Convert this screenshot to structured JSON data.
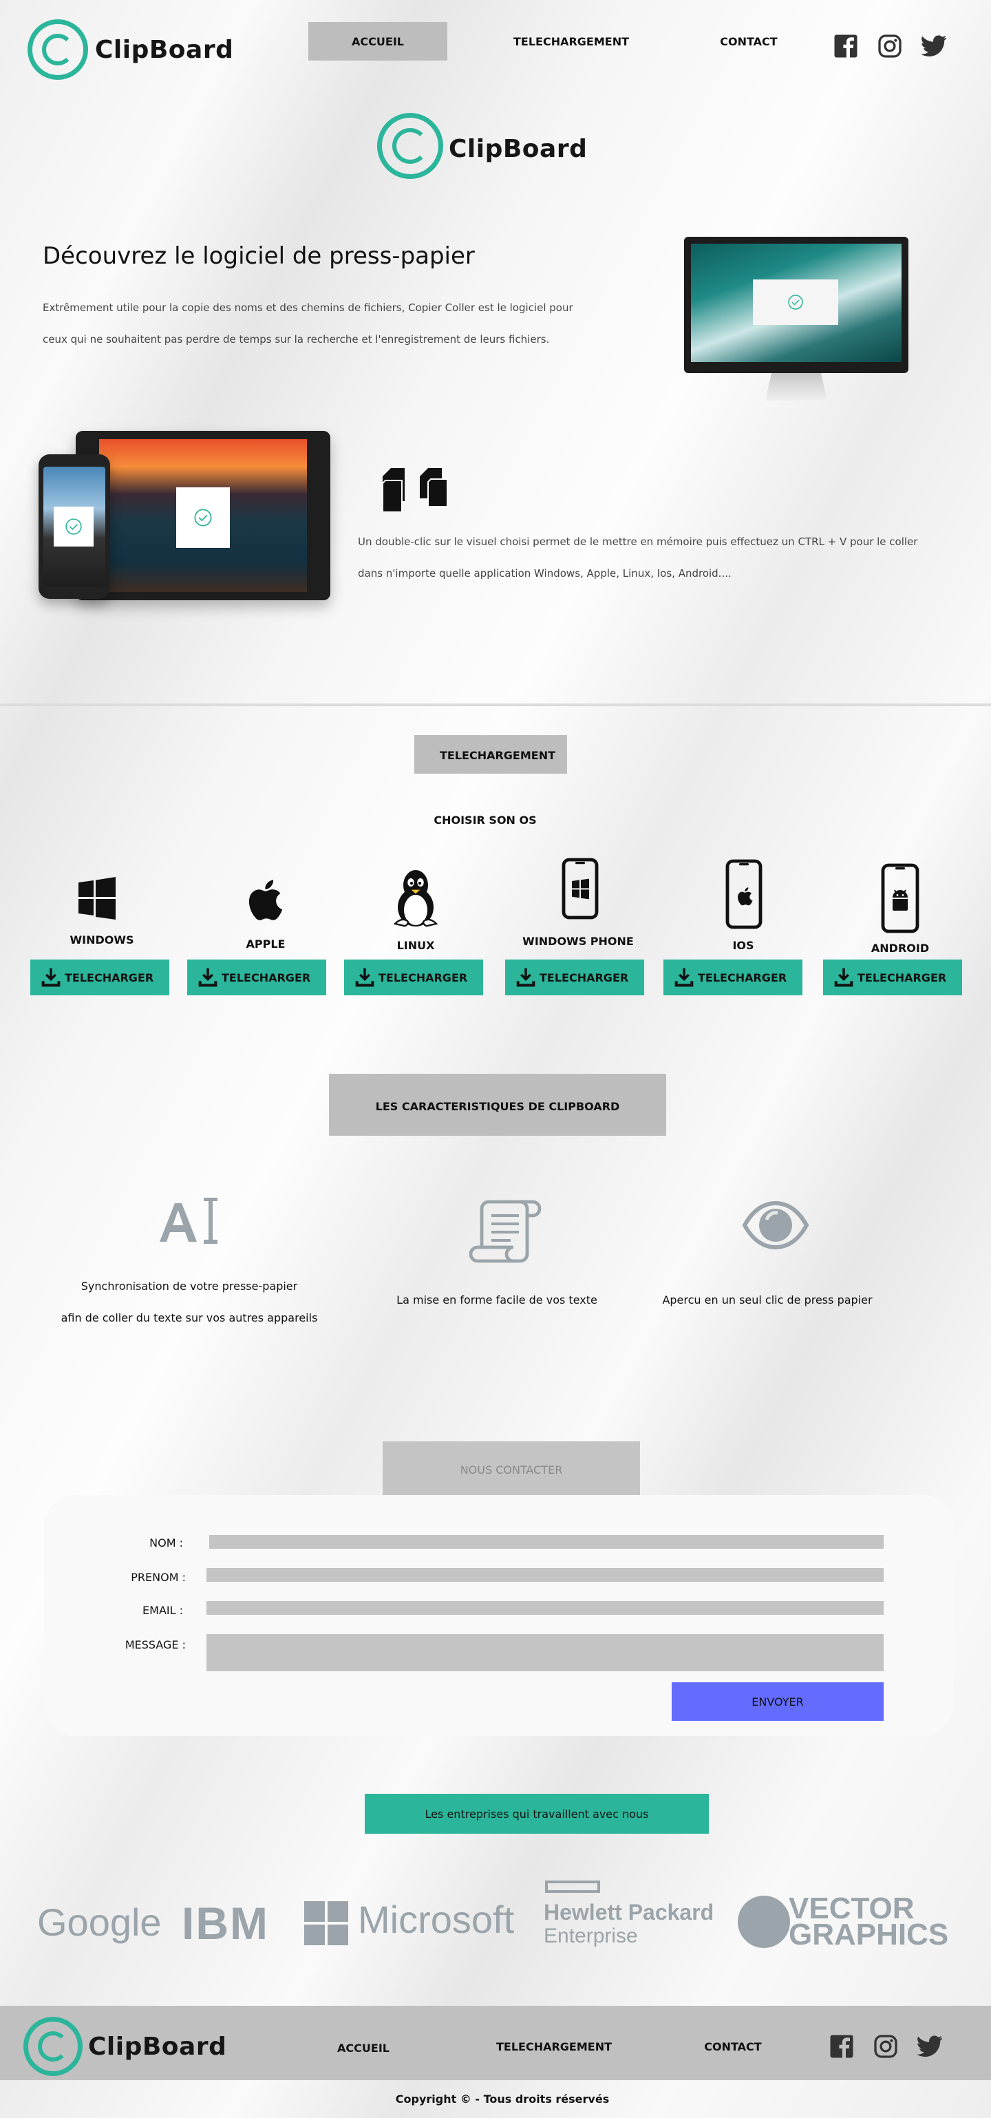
{
  "brand": {
    "name": "ClipBoard"
  },
  "nav": {
    "home": "ACCUEIL",
    "download": "TELECHARGEMENT",
    "contact": "CONTACT"
  },
  "hero": {
    "title": "Découvrez le logiciel de press-papier",
    "desc1": "Extrêmement utile pour la copie des noms et des chemins de fichiers, Copier Coller est le logiciel pour",
    "desc2": "ceux qui ne souhaitent pas perdre de temps sur la recherche et l'enregistrement de leurs fichiers.",
    "info1": "Un double-clic sur le visuel choisi permet de le mettre en mémoire puis effectuez un CTRL + V pour le coller",
    "info2": "dans n'importe quelle application Windows,  Apple, Linux, Ios, Android...."
  },
  "download": {
    "heading": "TELECHARGEMENT",
    "subheading": "CHOISIR SON OS",
    "button_label": "TELECHARGER",
    "os": [
      "WINDOWS",
      "APPLE",
      "LINUX",
      "WINDOWS PHONE",
      "IOS",
      "ANDROID"
    ]
  },
  "features": {
    "heading": "LES CARACTERISTIQUES DE CLIPBOARD",
    "items": [
      {
        "line1": "Synchronisation de votre presse-papier",
        "line2": "afin de coller du texte sur vos autres appareils",
        "icon": "text-ai-icon"
      },
      {
        "line1": "La mise en forme facile de vos texte",
        "line2": "",
        "icon": "scroll-document-icon"
      },
      {
        "line1": "Apercu en un seul clic de  press papier",
        "line2": "",
        "icon": "eye-icon"
      }
    ]
  },
  "contact": {
    "heading": "NOUS CONTACTER",
    "labels": {
      "nom": "NOM :",
      "prenom": "PRENOM :",
      "email": "EMAIL :",
      "message": "MESSAGE :"
    },
    "submit": "ENVOYER"
  },
  "partners": {
    "heading": "Les entreprises qui travaillent avec nous",
    "logos": {
      "google": "Google",
      "ibm": "IBM",
      "microsoft": "Microsoft",
      "hpe1": "Hewlett Packard",
      "hpe2": "Enterprise",
      "vector1": "VECTOR",
      "vector2": "GRAPHICS"
    }
  },
  "footer": {
    "copyright": "Copyright © - Tous droits réservés"
  },
  "colors": {
    "accent": "#2bb59a",
    "submit": "#636cff",
    "gray_box": "#bfbfbf",
    "footer": "#c0c0c0"
  }
}
